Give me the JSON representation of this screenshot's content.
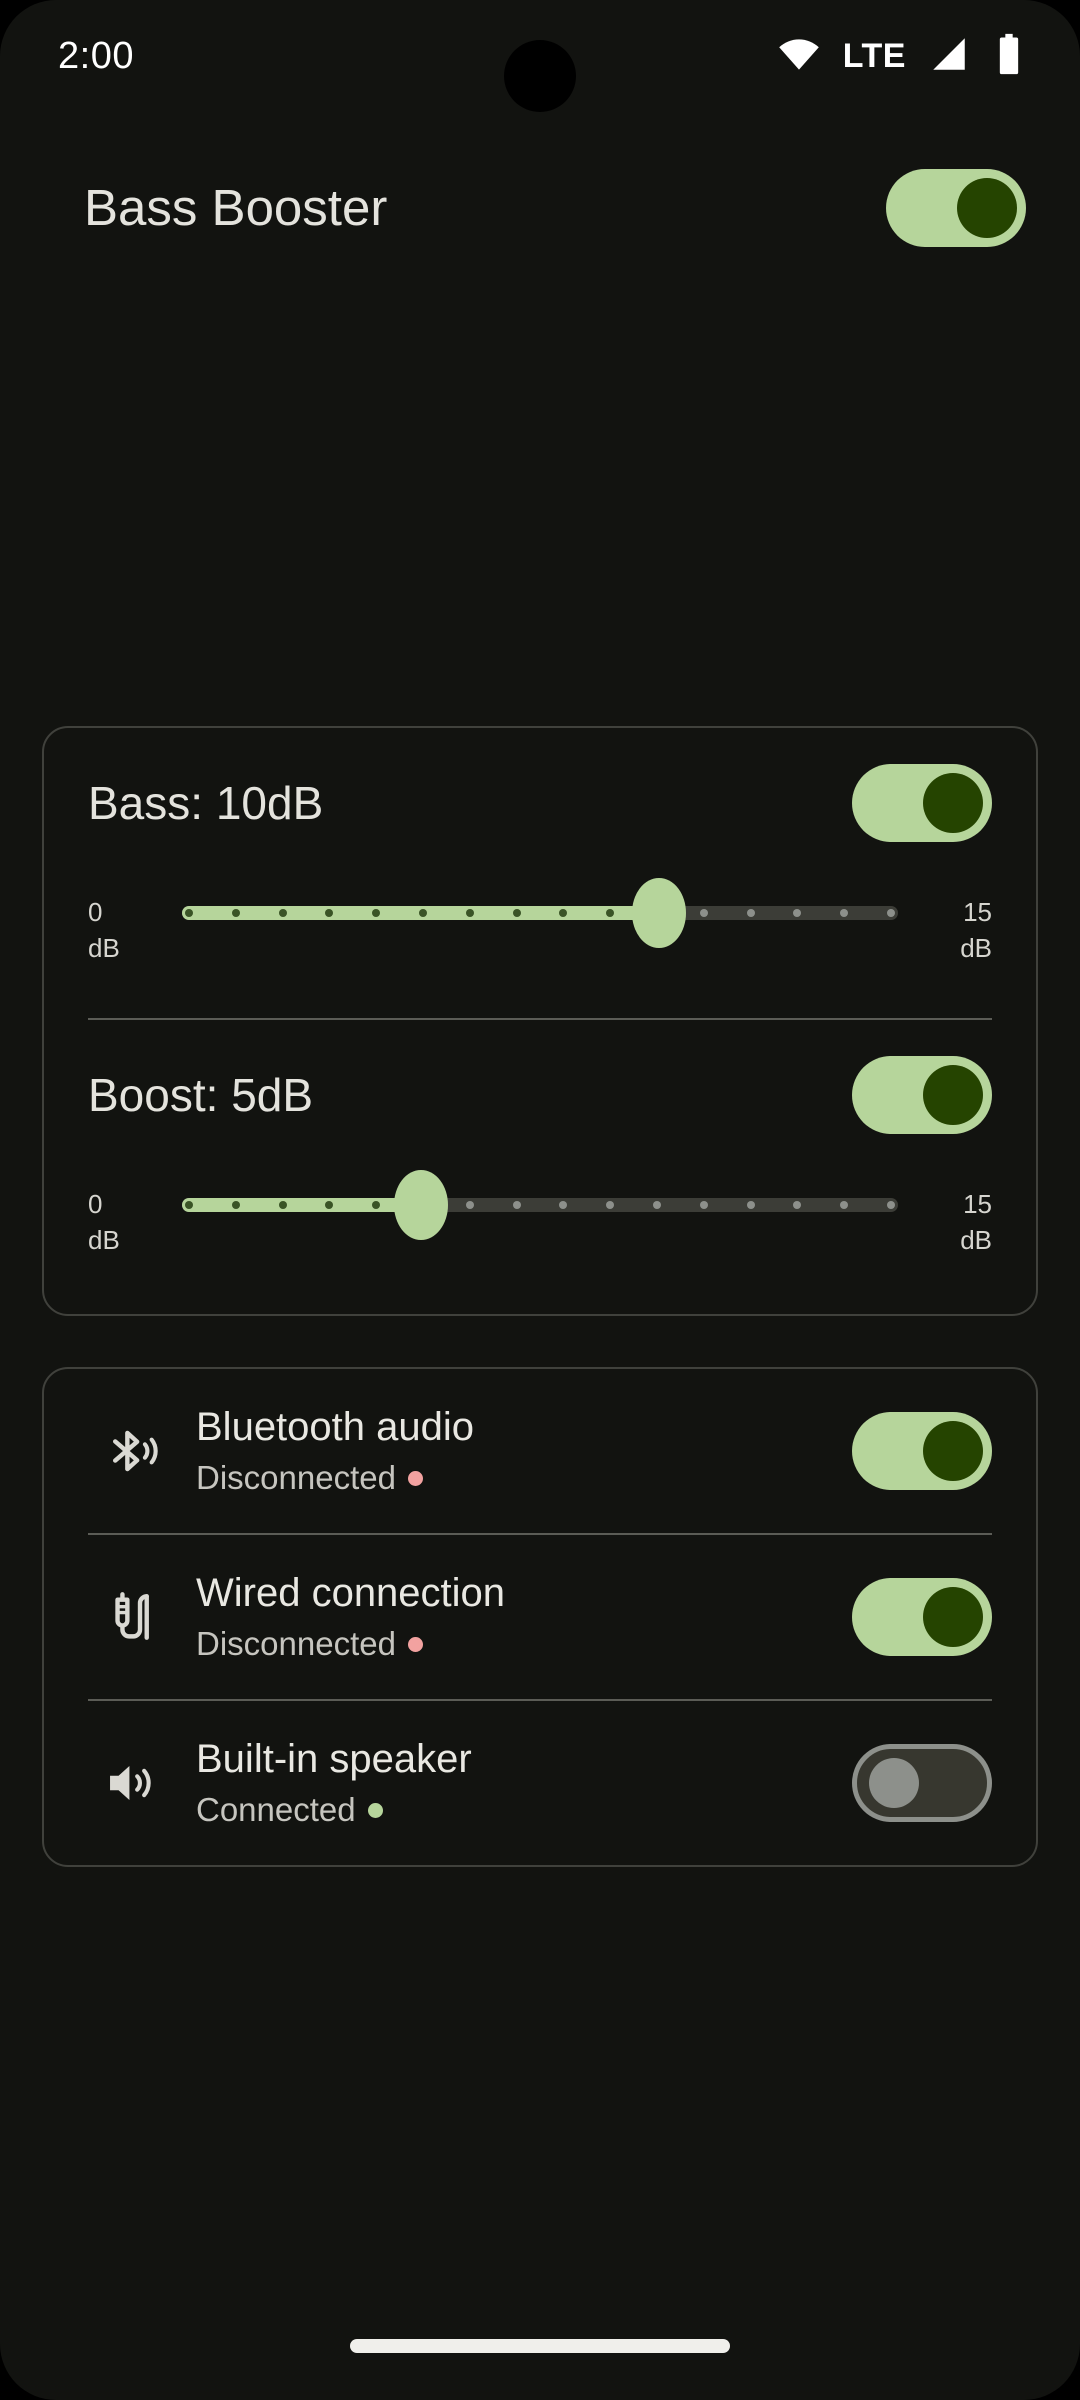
{
  "status_bar": {
    "time": "2:00",
    "network_label": "LTE",
    "icons": [
      "wifi-icon",
      "cellular-signal-icon",
      "battery-icon"
    ]
  },
  "header": {
    "title": "Bass Booster",
    "master_toggle": {
      "name": "master-enable-toggle",
      "state": "on"
    }
  },
  "equalizer": {
    "controls": [
      {
        "id": "bass",
        "label": "Bass: 10dB",
        "toggle_state": "on",
        "value": 10,
        "min": 0,
        "max": 15,
        "min_label_value": "0",
        "min_label_unit": "dB",
        "max_label_value": "15",
        "max_label_unit": "dB"
      },
      {
        "id": "boost",
        "label": "Boost: 5dB",
        "toggle_state": "on",
        "value": 5,
        "min": 0,
        "max": 15,
        "min_label_value": "0",
        "min_label_unit": "dB",
        "max_label_value": "15",
        "max_label_unit": "dB"
      }
    ]
  },
  "outputs": {
    "rows": [
      {
        "id": "bluetooth",
        "icon": "bluetooth-audio-icon",
        "name": "Bluetooth audio",
        "status": "Disconnected",
        "status_state": "disconnected",
        "toggle_state": "on"
      },
      {
        "id": "wired",
        "icon": "headphone-jack-icon",
        "name": "Wired connection",
        "status": "Disconnected",
        "status_state": "disconnected",
        "toggle_state": "on"
      },
      {
        "id": "speaker",
        "icon": "speaker-icon",
        "name": "Built-in speaker",
        "status": "Connected",
        "status_state": "connected",
        "toggle_state": "off"
      }
    ]
  },
  "colors": {
    "accent_green": "#b6d59b",
    "accent_green_dark": "#254400",
    "track_inactive": "#3c3d37",
    "toggle_off_track": "#37372f",
    "toggle_off_outline": "#8d908b",
    "status_disconnected": "#f2a2a0",
    "status_connected": "#b6d59b",
    "background": "#121310",
    "card_border": "#40413c",
    "text_primary": "#e4e3dd"
  }
}
